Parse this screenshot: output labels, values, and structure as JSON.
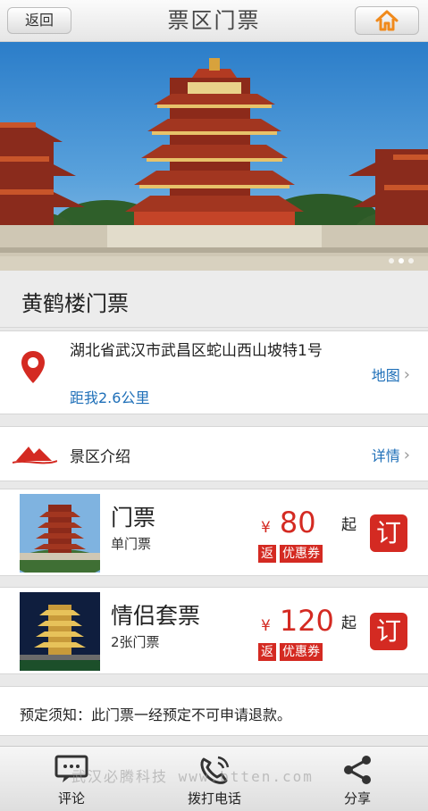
{
  "header": {
    "back_label": "返回",
    "title": "票区门票",
    "home_icon": "home-icon"
  },
  "banner": {
    "slide_count": 3,
    "active_slide": 1
  },
  "attraction": {
    "name": "黄鹤楼门票"
  },
  "address": {
    "icon": "location-pin-icon",
    "text": "湖北省武汉市武昌区蛇山西山坡特1号",
    "distance": "距我2.6公里",
    "map_link": "地图"
  },
  "intro": {
    "icon": "mountain-icon",
    "label": "景区介绍",
    "detail_link": "详情"
  },
  "tickets": [
    {
      "name": "门票",
      "subtitle": "单门票",
      "currency": "¥",
      "price": "80",
      "suffix": "起",
      "badge_rebate": "返",
      "badge_coupon": "优惠券",
      "order_label": "订"
    },
    {
      "name": "情侣套票",
      "subtitle": "2张门票",
      "currency": "¥",
      "price": "120",
      "suffix": "起",
      "badge_rebate": "返",
      "badge_coupon": "优惠券",
      "order_label": "订"
    }
  ],
  "notice": {
    "text": "预定须知：此门票一经预定不可申请退款。"
  },
  "toolbar": {
    "comment_label": "评论",
    "call_label": "拨打电话",
    "share_label": "分享"
  },
  "watermark": "武汉必腾科技 www.btten.com",
  "colors": {
    "accent_red": "#d42a22",
    "link_blue": "#1e6fb8",
    "home_orange": "#f08a1c"
  }
}
